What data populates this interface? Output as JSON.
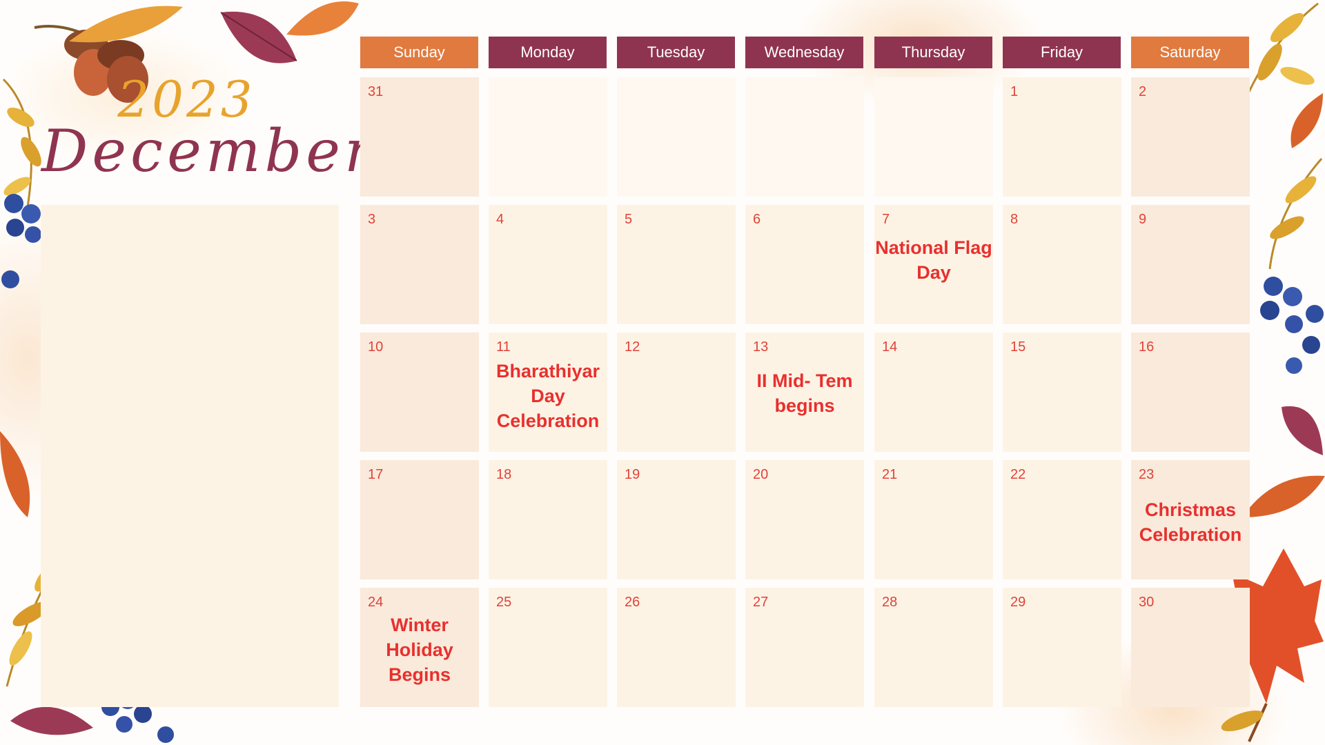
{
  "calendar": {
    "year": "2023",
    "month": "December",
    "weekdays": [
      {
        "label": "Sunday",
        "color": "#e17a3e"
      },
      {
        "label": "Monday",
        "color": "#8f3450"
      },
      {
        "label": "Tuesday",
        "color": "#8f3450"
      },
      {
        "label": "Wednesday",
        "color": "#8f3450"
      },
      {
        "label": "Thursday",
        "color": "#8f3450"
      },
      {
        "label": "Friday",
        "color": "#8f3450"
      },
      {
        "label": "Saturday",
        "color": "#e17a3e"
      }
    ],
    "weeks": [
      [
        {
          "day": "31",
          "event": ""
        },
        {
          "day": "",
          "event": ""
        },
        {
          "day": "",
          "event": ""
        },
        {
          "day": "",
          "event": ""
        },
        {
          "day": "",
          "event": ""
        },
        {
          "day": "1",
          "event": ""
        },
        {
          "day": "2",
          "event": ""
        }
      ],
      [
        {
          "day": "3",
          "event": ""
        },
        {
          "day": "4",
          "event": ""
        },
        {
          "day": "5",
          "event": ""
        },
        {
          "day": "6",
          "event": ""
        },
        {
          "day": "7",
          "event": "National Flag Day"
        },
        {
          "day": "8",
          "event": ""
        },
        {
          "day": "9",
          "event": ""
        }
      ],
      [
        {
          "day": "10",
          "event": ""
        },
        {
          "day": "11",
          "event": "Bharathiyar Day Celebration"
        },
        {
          "day": "12",
          "event": ""
        },
        {
          "day": "13",
          "event": "II Mid- Tem begins"
        },
        {
          "day": "14",
          "event": ""
        },
        {
          "day": "15",
          "event": ""
        },
        {
          "day": "16",
          "event": ""
        }
      ],
      [
        {
          "day": "17",
          "event": ""
        },
        {
          "day": "18",
          "event": ""
        },
        {
          "day": "19",
          "event": ""
        },
        {
          "day": "20",
          "event": ""
        },
        {
          "day": "21",
          "event": ""
        },
        {
          "day": "22",
          "event": ""
        },
        {
          "day": "23",
          "event": "Christmas Celebration"
        }
      ],
      [
        {
          "day": "24",
          "event": "Winter Holiday Begins"
        },
        {
          "day": "25",
          "event": ""
        },
        {
          "day": "26",
          "event": ""
        },
        {
          "day": "27",
          "event": ""
        },
        {
          "day": "28",
          "event": ""
        },
        {
          "day": "29",
          "event": ""
        },
        {
          "day": "30",
          "event": ""
        }
      ]
    ]
  },
  "colors": {
    "header_weekend": "#e17a3e",
    "header_weekday": "#8f3450",
    "cell_weekend": "#f9eadb",
    "cell_weekday": "#fdf3e5",
    "cell_empty": "#fef8f1",
    "day_number": "#e0423a",
    "event_text": "#e8302e",
    "year_text": "#e8a32c",
    "month_text": "#8f3450"
  },
  "decorations": {
    "icons": [
      "acorn-icon",
      "leaf-icon",
      "berries-icon",
      "maple-leaf-icon"
    ]
  }
}
